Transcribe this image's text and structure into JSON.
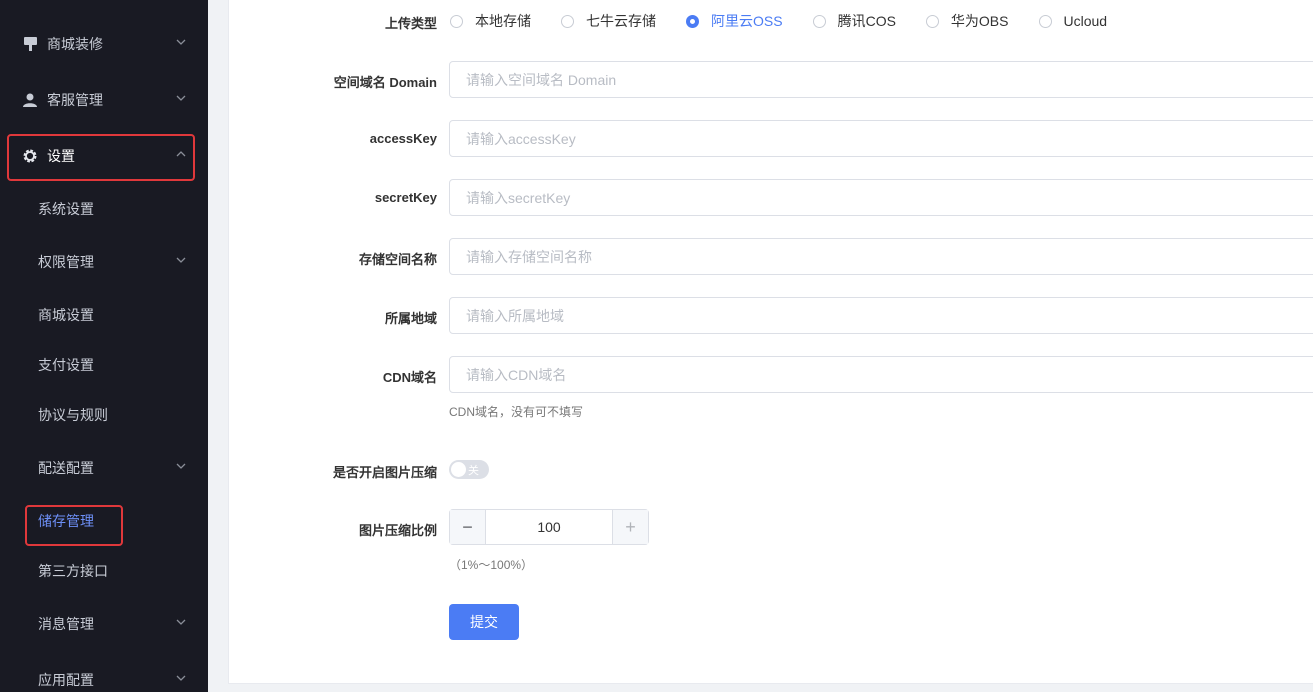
{
  "sidebar": {
    "items": [
      {
        "label": "商城装修",
        "icon": "brush-icon"
      },
      {
        "label": "客服管理",
        "icon": "user-icon"
      },
      {
        "label": "设置",
        "icon": "gear-icon"
      },
      {
        "label": "系统设置"
      },
      {
        "label": "权限管理"
      },
      {
        "label": "商城设置"
      },
      {
        "label": "支付设置"
      },
      {
        "label": "协议与规则"
      },
      {
        "label": "配送配置"
      },
      {
        "label": "储存管理"
      },
      {
        "label": "第三方接口"
      },
      {
        "label": "消息管理"
      },
      {
        "label": "应用配置"
      }
    ]
  },
  "form": {
    "upload_type": {
      "label": "上传类型",
      "options": [
        "本地存储",
        "七牛云存储",
        "阿里云OSS",
        "腾讯COS",
        "华为OBS",
        "Ucloud"
      ],
      "selected": "阿里云OSS"
    },
    "domain": {
      "label": "空间域名 Domain",
      "placeholder": "请输入空间域名 Domain"
    },
    "access_key": {
      "label": "accessKey",
      "placeholder": "请输入accessKey"
    },
    "secret_key": {
      "label": "secretKey",
      "placeholder": "请输入secretKey"
    },
    "bucket": {
      "label": "存储空间名称",
      "placeholder": "请输入存储空间名称"
    },
    "region": {
      "label": "所属地域",
      "placeholder": "请输入所属地域"
    },
    "cdn": {
      "label": "CDN域名",
      "placeholder": "请输入CDN域名",
      "hint": "CDN域名，没有可不填写"
    },
    "compress": {
      "label": "是否开启图片压缩",
      "switch_text": "关"
    },
    "ratio": {
      "label": "图片压缩比例",
      "value": "100",
      "hint": "（1%～100%）",
      "minus": "−",
      "plus": "+"
    },
    "submit_label": "提交"
  },
  "colors": {
    "accent": "#4b7cf4",
    "sidebar_bg": "#191a23",
    "highlight_border": "#e0383b"
  }
}
